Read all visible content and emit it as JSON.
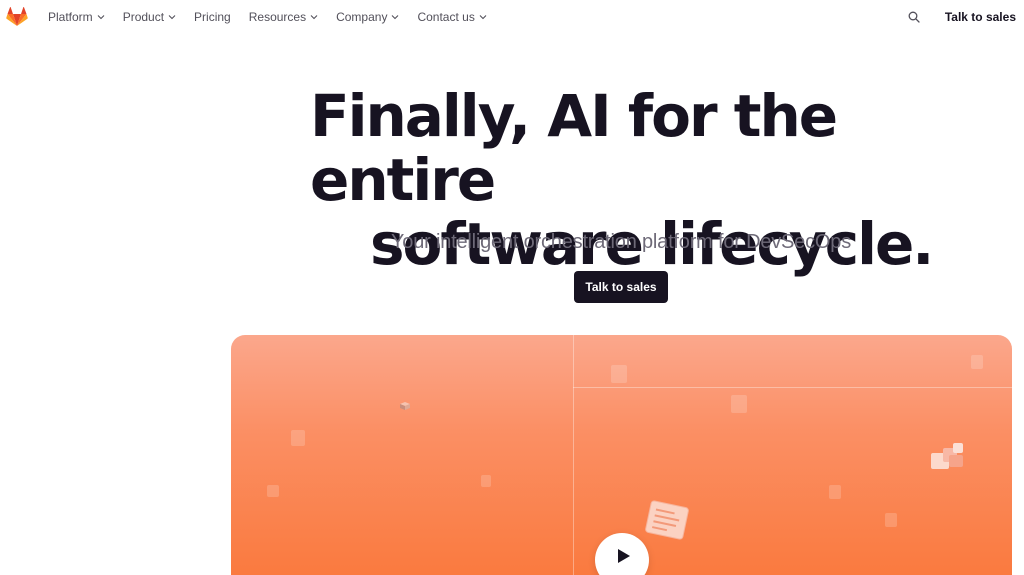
{
  "nav": {
    "logo": "gitlab-logo",
    "items": [
      {
        "label": "Platform",
        "has_dropdown": true
      },
      {
        "label": "Product",
        "has_dropdown": true
      },
      {
        "label": "Pricing",
        "has_dropdown": false
      },
      {
        "label": "Resources",
        "has_dropdown": true
      },
      {
        "label": "Company",
        "has_dropdown": true
      },
      {
        "label": "Contact us",
        "has_dropdown": true
      }
    ],
    "search_icon": "search-icon",
    "cta_label": "Talk to sales"
  },
  "hero": {
    "title_line1": "Finally, AI for the entire",
    "title_line2": "software lifecycle.",
    "subtitle": "Your intelligent orchestration platform for DevSecOps",
    "cta_label": "Talk to sales"
  },
  "video": {
    "play_icon": "play-icon"
  },
  "colors": {
    "text_dark": "#171321",
    "nav_text": "#52505a",
    "subtitle": "#6e6a78",
    "video_top": "#fba78c",
    "video_bottom": "#fa7a3f",
    "logo_orange": "#e24329"
  }
}
